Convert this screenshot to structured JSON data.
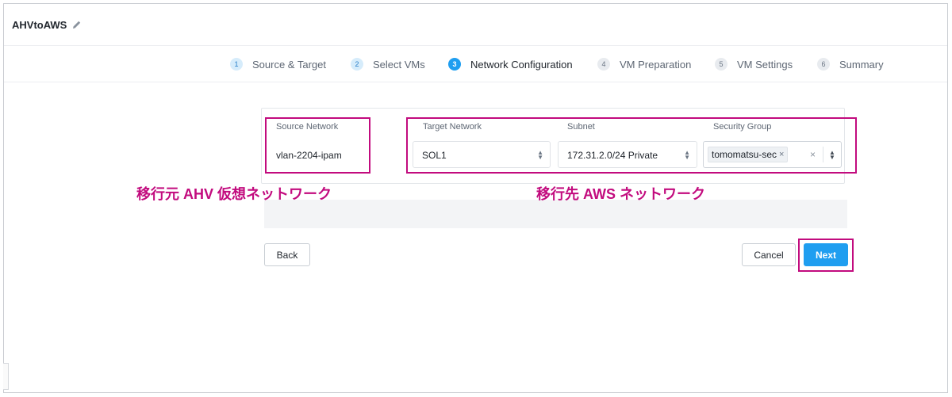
{
  "header": {
    "plan_name": "AHVtoAWS"
  },
  "steps": [
    {
      "number": "1",
      "label": "Source & Target",
      "state": "done"
    },
    {
      "number": "2",
      "label": "Select VMs",
      "state": "done"
    },
    {
      "number": "3",
      "label": "Network Configuration",
      "state": "active"
    },
    {
      "number": "4",
      "label": "VM Preparation",
      "state": "pending"
    },
    {
      "number": "5",
      "label": "VM Settings",
      "state": "pending"
    },
    {
      "number": "6",
      "label": "Summary",
      "state": "pending"
    }
  ],
  "table": {
    "columns": {
      "source": "Source Network",
      "target": "Target Network",
      "subnet": "Subnet",
      "security": "Security Group"
    },
    "row": {
      "source_network": "vlan-2204-ipam",
      "target_network": "SOL1",
      "subnet": "172.31.2.0/24 Private",
      "security_group_tag": "tomomatsu-sec"
    }
  },
  "buttons": {
    "back": "Back",
    "cancel": "Cancel",
    "next": "Next"
  },
  "annotations": {
    "source_label": "移行元 AHV 仮想ネットワーク",
    "target_label": "移行先 AWS ネットワーク"
  },
  "colors": {
    "accent": "#1f9ef0",
    "annotation": "#c20b7e"
  },
  "icons": {
    "edit": "pencil-icon",
    "select_arrow": "updown-arrow-icon",
    "clear": "close-icon"
  }
}
